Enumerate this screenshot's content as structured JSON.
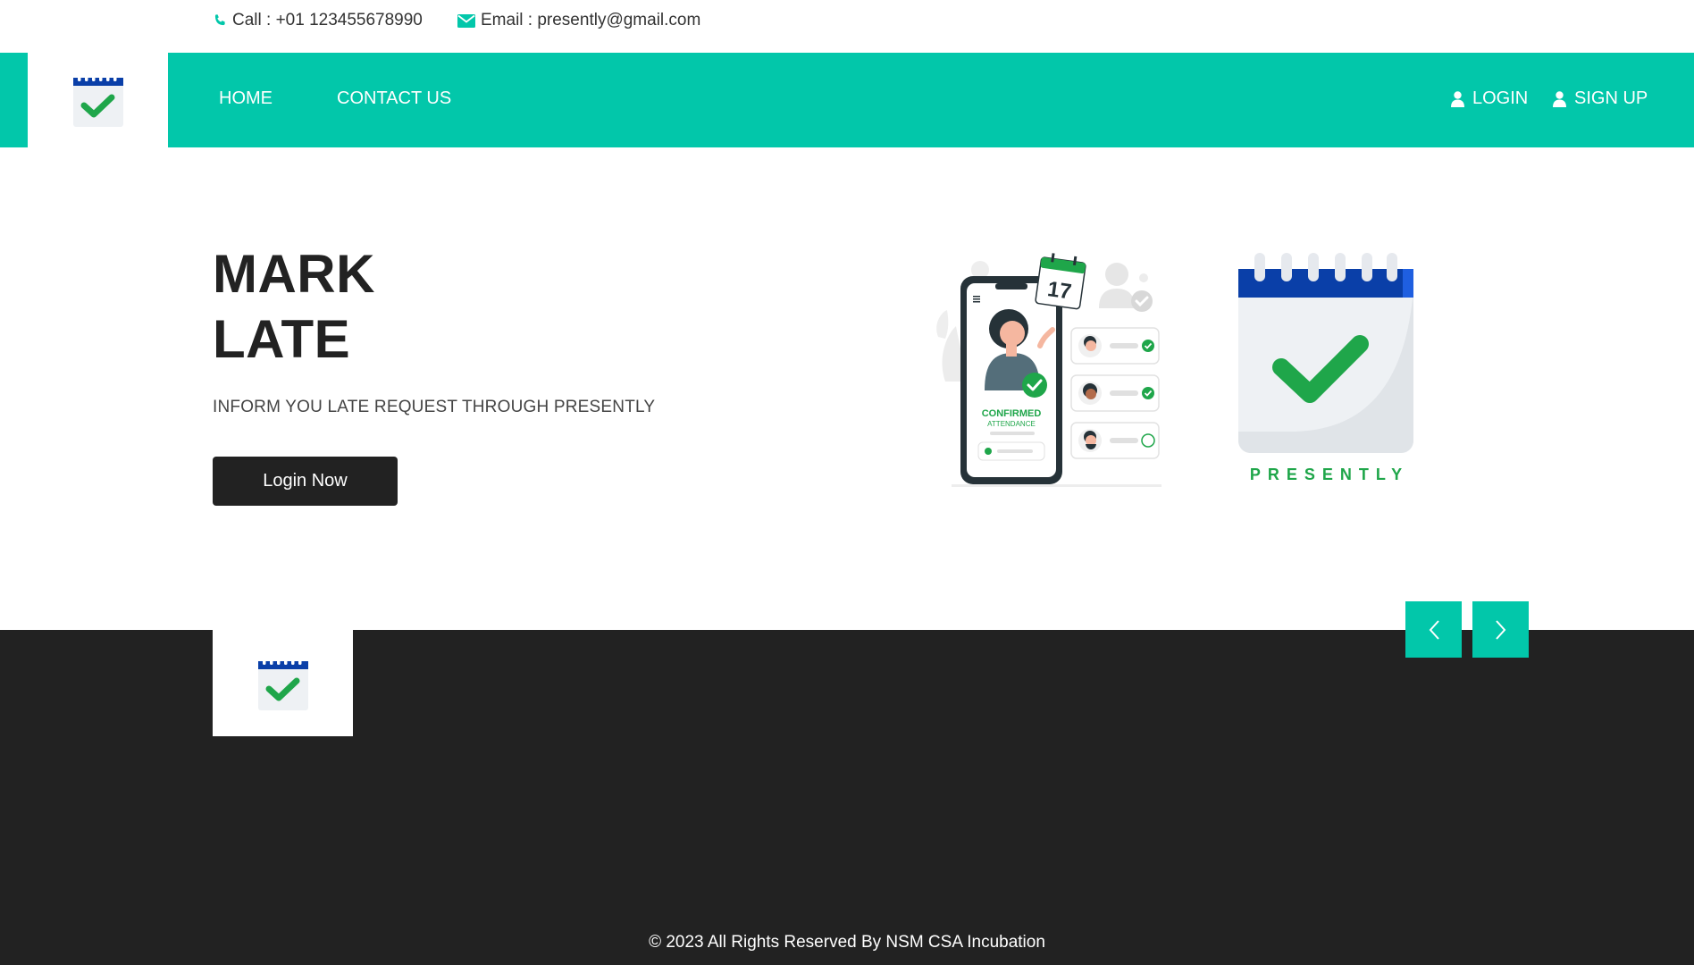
{
  "topbar": {
    "call": "Call : +01 123455678990",
    "email": "Email : presently@gmail.com"
  },
  "nav": {
    "home": "HOME",
    "contact": "CONTACT US",
    "login": "LOGIN",
    "signup": "SIGN UP"
  },
  "hero": {
    "title_line1": "MARK",
    "title_line2": "LATE",
    "subtitle": "INFORM YOU LATE REQUEST THROUGH PRESENTLY",
    "button": "Login Now"
  },
  "illustration": {
    "date": "17",
    "confirmed": "CONFIRMED",
    "attendance": "ATTENDANCE"
  },
  "brand": {
    "wordmark": "PRESENTLY"
  },
  "footer": {
    "copyright": "© 2023 All Rights Reserved By NSM CSA Incubation"
  },
  "colors": {
    "accent": "#02c7aa",
    "dark": "#222222",
    "brand_green": "#1fa64a",
    "brand_blue": "#0a3fa8"
  },
  "icons": {
    "call": "phone-icon",
    "email": "envelope-icon",
    "login": "user-icon",
    "signup": "user-icon",
    "prev": "chevron-left-icon",
    "next": "chevron-right-icon"
  }
}
